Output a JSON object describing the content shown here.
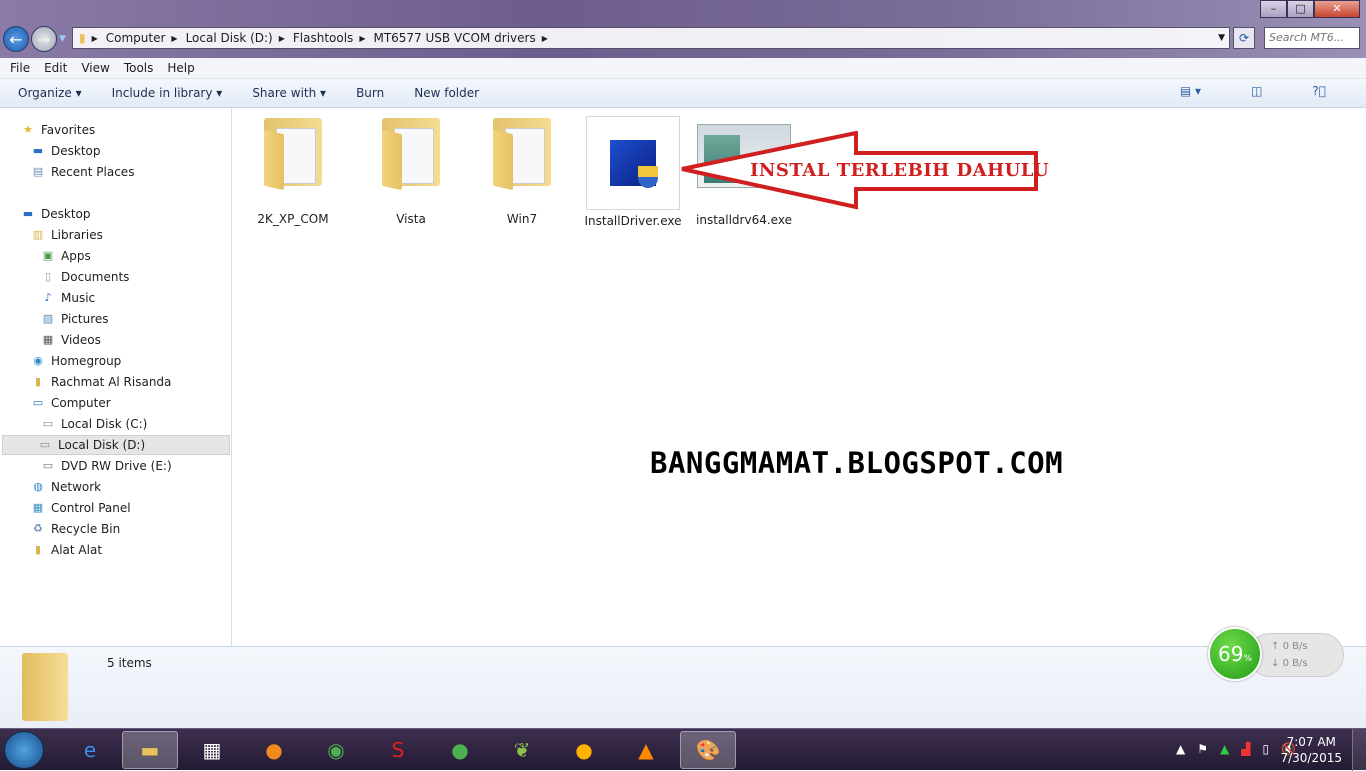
{
  "window": {
    "controls": [
      "minimize",
      "maximize",
      "close"
    ]
  },
  "address": {
    "crumbs": [
      "Computer",
      "Local Disk (D:)",
      "Flashtools",
      "MT6577 USB VCOM drivers"
    ],
    "search_placeholder": "Search MT6..."
  },
  "menu": [
    "File",
    "Edit",
    "View",
    "Tools",
    "Help"
  ],
  "toolbar": {
    "organize": "Organize ▾",
    "include": "Include in library ▾",
    "share": "Share with ▾",
    "burn": "Burn",
    "new_folder": "New folder"
  },
  "sidebar": [
    {
      "label": "Favorites",
      "icon": "star-icon",
      "level": 0
    },
    {
      "label": "Desktop",
      "icon": "desktop-icon",
      "level": 1
    },
    {
      "label": "Recent Places",
      "icon": "recent-places-icon",
      "level": 1
    },
    {
      "label": "Desktop",
      "icon": "desktop-icon",
      "level": 0
    },
    {
      "label": "Libraries",
      "icon": "libraries-icon",
      "level": 1
    },
    {
      "label": "Apps",
      "icon": "apps-icon",
      "level": 2
    },
    {
      "label": "Documents",
      "icon": "documents-icon",
      "level": 2
    },
    {
      "label": "Music",
      "icon": "music-icon",
      "level": 2
    },
    {
      "label": "Pictures",
      "icon": "pictures-icon",
      "level": 2
    },
    {
      "label": "Videos",
      "icon": "videos-icon",
      "level": 2
    },
    {
      "label": "Homegroup",
      "icon": "homegroup-icon",
      "level": 1
    },
    {
      "label": "Rachmat Al Risanda",
      "icon": "user-folder-icon",
      "level": 1
    },
    {
      "label": "Computer",
      "icon": "computer-icon",
      "level": 1
    },
    {
      "label": "Local Disk (C:)",
      "icon": "drive-icon",
      "level": 2
    },
    {
      "label": "Local Disk (D:)",
      "icon": "drive-icon",
      "level": 2,
      "selected": true
    },
    {
      "label": "DVD RW Drive (E:)",
      "icon": "dvd-drive-icon",
      "level": 2
    },
    {
      "label": "Network",
      "icon": "network-icon",
      "level": 1
    },
    {
      "label": "Control Panel",
      "icon": "control-panel-icon",
      "level": 1
    },
    {
      "label": "Recycle Bin",
      "icon": "recycle-bin-icon",
      "level": 1
    },
    {
      "label": "Alat Alat",
      "icon": "folder-icon",
      "level": 1
    }
  ],
  "files": [
    {
      "name": "2K_XP_COM",
      "type": "folder"
    },
    {
      "name": "Vista",
      "type": "folder"
    },
    {
      "name": "Win7",
      "type": "folder"
    },
    {
      "name": "InstallDriver.exe",
      "type": "exe"
    },
    {
      "name": "installdrv64.exe",
      "type": "exe-window"
    }
  ],
  "annotation": "INSTAL TERLEBIH DAHULU",
  "watermark": "BANGGMAMAT.BLOGSPOT.COM",
  "details": {
    "count": "5 items"
  },
  "meter": {
    "percent": "69",
    "unit": "%",
    "up": "0 B/s",
    "down": "0 B/s"
  },
  "clock": {
    "time": "7:07 AM",
    "date": "7/30/2015"
  },
  "colors": {
    "annotation": "#d11e1e",
    "meter": "#2fb11f"
  }
}
